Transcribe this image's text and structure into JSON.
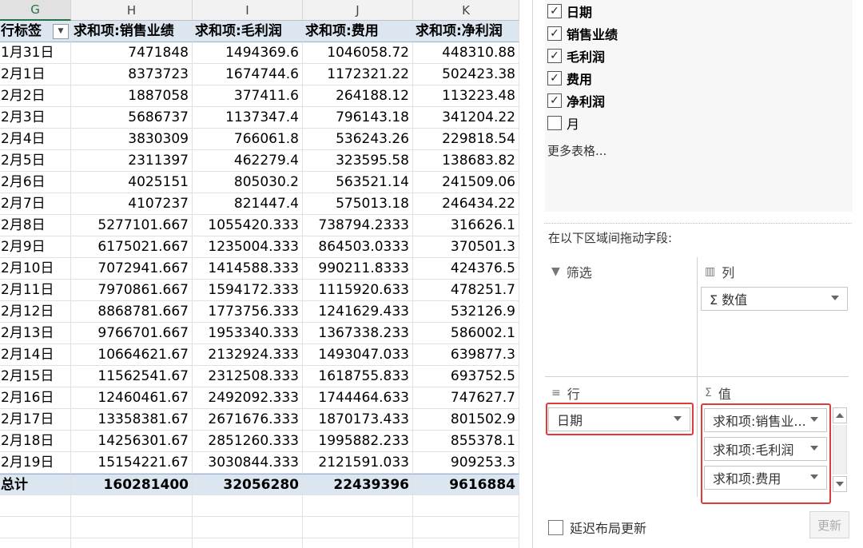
{
  "sheet": {
    "columns": [
      "G",
      "H",
      "I",
      "J",
      "K"
    ],
    "headers": [
      "行标签",
      "求和项:销售业绩",
      "求和项:毛利润",
      "求和项:费用",
      "求和项:净利润"
    ],
    "rows": [
      [
        "1月31日",
        "7471848",
        "1494369.6",
        "1046058.72",
        "448310.88"
      ],
      [
        "2月1日",
        "8373723",
        "1674744.6",
        "1172321.22",
        "502423.38"
      ],
      [
        "2月2日",
        "1887058",
        "377411.6",
        "264188.12",
        "113223.48"
      ],
      [
        "2月3日",
        "5686737",
        "1137347.4",
        "796143.18",
        "341204.22"
      ],
      [
        "2月4日",
        "3830309",
        "766061.8",
        "536243.26",
        "229818.54"
      ],
      [
        "2月5日",
        "2311397",
        "462279.4",
        "323595.58",
        "138683.82"
      ],
      [
        "2月6日",
        "4025151",
        "805030.2",
        "563521.14",
        "241509.06"
      ],
      [
        "2月7日",
        "4107237",
        "821447.4",
        "575013.18",
        "246434.22"
      ],
      [
        "2月8日",
        "5277101.667",
        "1055420.333",
        "738794.2333",
        "316626.1"
      ],
      [
        "2月9日",
        "6175021.667",
        "1235004.333",
        "864503.0333",
        "370501.3"
      ],
      [
        "2月10日",
        "7072941.667",
        "1414588.333",
        "990211.8333",
        "424376.5"
      ],
      [
        "2月11日",
        "7970861.667",
        "1594172.333",
        "1115920.633",
        "478251.7"
      ],
      [
        "2月12日",
        "8868781.667",
        "1773756.333",
        "1241629.433",
        "532126.9"
      ],
      [
        "2月13日",
        "9766701.667",
        "1953340.333",
        "1367338.233",
        "586002.1"
      ],
      [
        "2月14日",
        "10664621.67",
        "2132924.333",
        "1493047.033",
        "639877.3"
      ],
      [
        "2月15日",
        "11562541.67",
        "2312508.333",
        "1618755.833",
        "693752.5"
      ],
      [
        "2月16日",
        "12460461.67",
        "2492092.333",
        "1744464.633",
        "747627.7"
      ],
      [
        "2月17日",
        "13358381.67",
        "2671676.333",
        "1870173.433",
        "801502.9"
      ],
      [
        "2月18日",
        "14256301.67",
        "2851260.333",
        "1995882.233",
        "855378.1"
      ],
      [
        "2月19日",
        "15154221.67",
        "3030844.333",
        "2121591.033",
        "909253.3"
      ]
    ],
    "total": [
      "总计",
      "160281400",
      "32056280",
      "22439396",
      "9616884"
    ]
  },
  "pane": {
    "fields": [
      {
        "label": "日期",
        "checked": true
      },
      {
        "label": "销售业绩",
        "checked": true
      },
      {
        "label": "毛利润",
        "checked": true
      },
      {
        "label": "费用",
        "checked": true
      },
      {
        "label": "净利润",
        "checked": true
      },
      {
        "label": "月",
        "checked": false
      }
    ],
    "more_tables": "更多表格...",
    "drag_hint": "在以下区域间拖动字段:",
    "areas": {
      "filter": {
        "label": "筛选",
        "icon": "filter-icon"
      },
      "columns": {
        "label": "列",
        "icon": "columns-icon",
        "items": [
          "Σ 数值"
        ]
      },
      "rows": {
        "label": "行",
        "icon": "rows-icon",
        "items": [
          "日期"
        ]
      },
      "values": {
        "label": "值",
        "icon": "sigma-icon",
        "items": [
          "求和项:销售业...",
          "求和项:毛利润",
          "求和项:费用"
        ]
      }
    },
    "defer_label": "延迟布局更新",
    "update_label": "更新"
  },
  "colors": {
    "header_fill": "#dce6f1",
    "highlight": "#e03b3b",
    "selected_col": "#217346"
  }
}
